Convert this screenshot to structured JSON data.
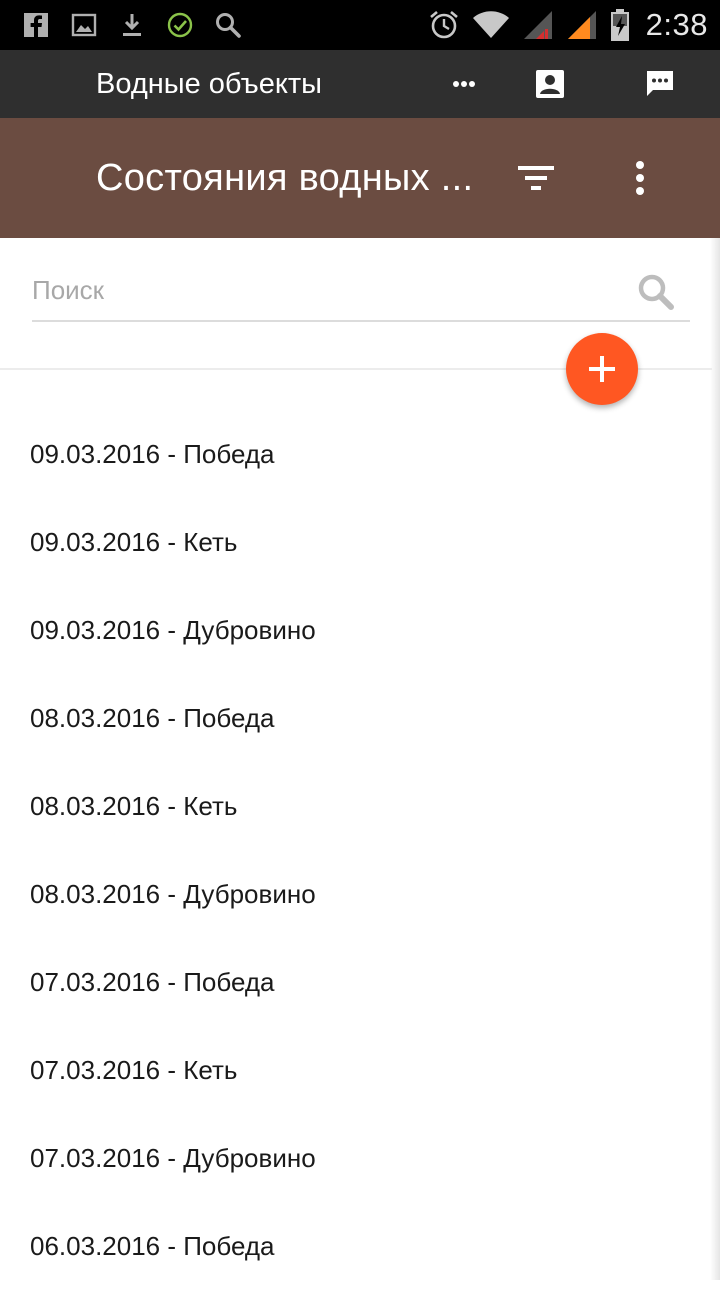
{
  "status_bar": {
    "left_icons": [
      "facebook-icon",
      "gallery-icon",
      "download-icon",
      "check-circle-icon",
      "search-icon"
    ],
    "right_icons": [
      "alarm-icon",
      "wifi-icon",
      "signal-sim1-icon",
      "signal-sim2-icon",
      "battery-charging-icon"
    ],
    "time": "2:38",
    "colors": {
      "check": "#8bc34a",
      "signal_orange": "#ff8a1f",
      "signal_red": "#d32f2f"
    }
  },
  "app_header": {
    "title": "Водные объекты",
    "actions": [
      "more-horizontal-icon",
      "contact-icon",
      "chat-icon"
    ]
  },
  "toolbar": {
    "title": "Состояния водных ...",
    "actions": [
      "filter-icon",
      "more-vertical-icon"
    ],
    "color": "#6b4c41"
  },
  "search": {
    "placeholder": "Поиск",
    "value": ""
  },
  "fab": {
    "icon": "plus-icon",
    "color": "#ff5722"
  },
  "list": {
    "items": [
      "09.03.2016 - Победа",
      "09.03.2016 - Кеть",
      "09.03.2016 - Дубровино",
      "08.03.2016 - Победа",
      "08.03.2016 - Кеть",
      "08.03.2016 - Дубровино",
      "07.03.2016 - Победа",
      "07.03.2016 - Кеть",
      "07.03.2016 - Дубровино",
      "06.03.2016 - Победа"
    ]
  }
}
